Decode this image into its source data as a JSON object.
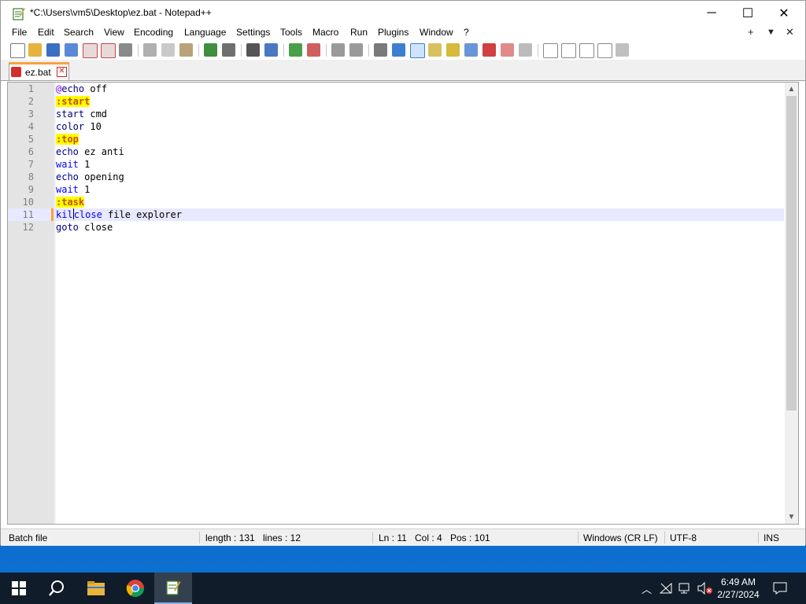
{
  "window": {
    "title": "*C:\\Users\\vm5\\Desktop\\ez.bat - Notepad++",
    "minimize": "─",
    "maximize": "☐",
    "close": "✕"
  },
  "menu": {
    "items": [
      "File",
      "Edit",
      "Search",
      "View",
      "Encoding",
      "Language",
      "Settings",
      "Tools",
      "Macro",
      "Run",
      "Plugins",
      "Window",
      "?"
    ],
    "right_plus": "+",
    "right_down": "▼",
    "right_close": "✕"
  },
  "tab": {
    "label": "ez.bat",
    "close": "✕"
  },
  "editor": {
    "lines": [
      {
        "n": "1"
      },
      {
        "n": "2"
      },
      {
        "n": "3"
      },
      {
        "n": "4"
      },
      {
        "n": "5"
      },
      {
        "n": "6"
      },
      {
        "n": "7"
      },
      {
        "n": "8"
      },
      {
        "n": "9"
      },
      {
        "n": "10"
      },
      {
        "n": "11"
      },
      {
        "n": "12"
      }
    ],
    "code": {
      "l1_at": "@",
      "l1_cmd": "echo",
      "l1_rest": " off",
      "l2": ":start",
      "l3_cmd": "start",
      "l3_rest": " cmd",
      "l4_cmd": "color",
      "l4_rest": " 10",
      "l5": ":top",
      "l6_cmd": "echo",
      "l6_rest": " ez anti",
      "l7_cmd": "wait",
      "l7_rest": " 1",
      "l8_cmd": "echo",
      "l8_rest": " opening",
      "l9_cmd": "wait",
      "l9_rest": " 1",
      "l10": ":task",
      "l11_pre": "kil",
      "l11_kw": "close",
      "l11_rest": " file explorer",
      "l12_cmd": "goto",
      "l12_rest": " close"
    }
  },
  "status": {
    "language": "Batch file",
    "length": "length : 131",
    "lines": "lines : 12",
    "ln": "Ln : 11",
    "col": "Col : 4",
    "pos": "Pos : 101",
    "eol": "Windows (CR LF)",
    "encoding": "UTF-8",
    "mode": "INS"
  },
  "taskbar": {
    "time": "6:49 AM",
    "date": "2/27/2024"
  }
}
